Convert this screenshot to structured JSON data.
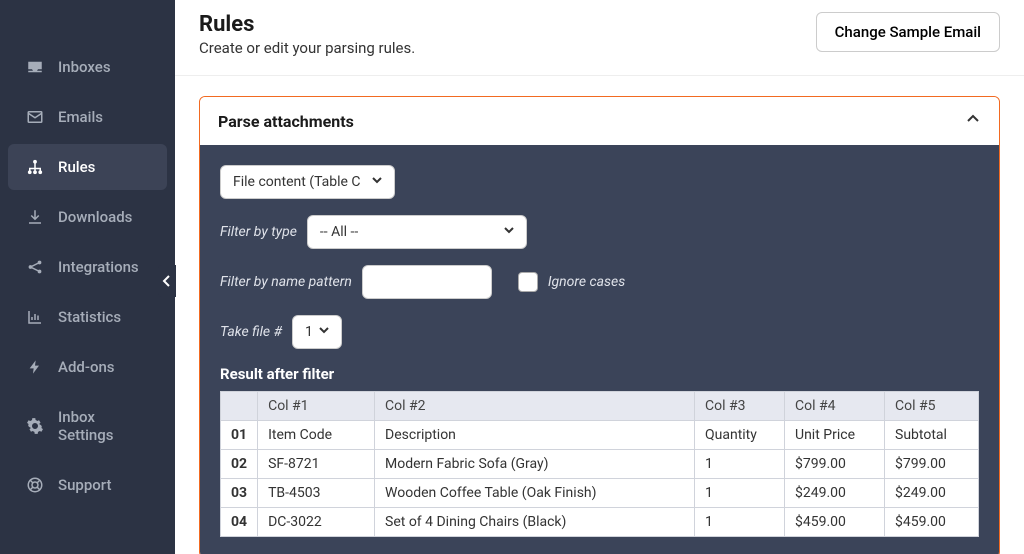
{
  "sidebar": {
    "items": [
      {
        "label": "Inboxes",
        "icon": "inbox"
      },
      {
        "label": "Emails",
        "icon": "envelope"
      },
      {
        "label": "Rules",
        "icon": "sitemap",
        "active": true
      },
      {
        "label": "Downloads",
        "icon": "download"
      },
      {
        "label": "Integrations",
        "icon": "share"
      },
      {
        "label": "Statistics",
        "icon": "chart"
      },
      {
        "label": "Add-ons",
        "icon": "bolt"
      },
      {
        "label": "Inbox Settings",
        "icon": "gear"
      },
      {
        "label": "Support",
        "icon": "lifering"
      }
    ]
  },
  "header": {
    "title": "Rules",
    "subtitle": "Create or edit your parsing rules.",
    "change_email": "Change Sample Email"
  },
  "panel": {
    "title": "Parse attachments",
    "source_select": "File content (Table Cells)",
    "filter_type_label": "Filter by type",
    "filter_type_value": "-- All --",
    "filter_name_label": "Filter by name pattern",
    "filter_name_value": "",
    "ignore_cases_label": "Ignore cases",
    "take_file_label": "Take file #",
    "take_file_value": "1",
    "result_title": "Result after filter",
    "columns": [
      "Col #1",
      "Col #2",
      "Col #3",
      "Col #4",
      "Col #5"
    ],
    "rows": [
      {
        "num": "01",
        "c1": "Item Code",
        "c2": "Description",
        "c3": "Quantity",
        "c4": "Unit Price",
        "c5": "Subtotal"
      },
      {
        "num": "02",
        "c1": "SF-8721",
        "c2": "Modern Fabric Sofa (Gray)",
        "c3": "1",
        "c4": "$799.00",
        "c5": "$799.00"
      },
      {
        "num": "03",
        "c1": "TB-4503",
        "c2": "Wooden Coffee Table (Oak Finish)",
        "c3": "1",
        "c4": "$249.00",
        "c5": "$249.00"
      },
      {
        "num": "04",
        "c1": "DC-3022",
        "c2": "Set of 4 Dining Chairs (Black)",
        "c3": "1",
        "c4": "$459.00",
        "c5": "$459.00"
      }
    ]
  }
}
